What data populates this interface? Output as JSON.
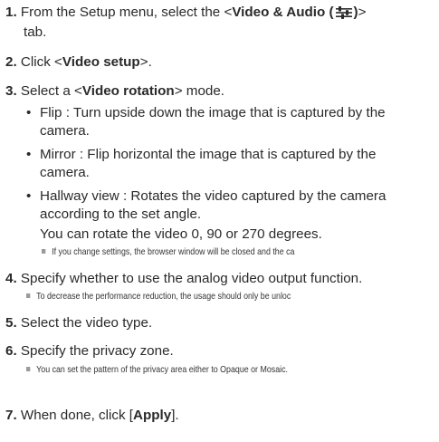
{
  "steps": {
    "s1": {
      "num": "1.",
      "pre": "From the Setup menu, select the <",
      "bold": "Video & Audio (",
      "bold_end": ")",
      "post": ">",
      "line2": "tab."
    },
    "s2": {
      "num": "2.",
      "pre": "Click <",
      "bold": "Video setup",
      "post": ">."
    },
    "s3": {
      "num": "3.",
      "pre": "Select a <",
      "bold": "Video rotation",
      "post": "> mode."
    },
    "s4": {
      "num": "4.",
      "text": "Specify whether to use the analog video output function."
    },
    "s5": {
      "num": "5.",
      "text": "Select the video type."
    },
    "s6": {
      "num": "6.",
      "text": "Specify the privacy zone."
    },
    "s7": {
      "num": "7.",
      "pre": "When done, click [",
      "bold": "Apply",
      "post": "]."
    }
  },
  "bullets": {
    "flip": {
      "line1": "Flip : Turn upside down the image that is captured by the",
      "line2": "camera."
    },
    "mirror": {
      "line1": "Mirror : Flip horizontal the image that is captured by the",
      "line2": "camera."
    },
    "hallway": {
      "line1": "Hallway view : Rotates the video captured by the camera",
      "line2": "according to the set angle.",
      "line3": "You can rotate the video 0, 90 or 270 degrees."
    }
  },
  "notes": {
    "n3": "If you change settings, the browser window will be closed and the ca",
    "n4": "To decrease the performance reduction, the usage should only be unloc",
    "n6": "You can set the pattern of the privacy area either to Opaque or Mosaic."
  },
  "icons": {
    "tab_icon": "video-audio-sliders-icon",
    "bullet_glyph": "•"
  },
  "colors": {
    "text": "#2a2a2a",
    "note_square": "#9a9a9a"
  }
}
